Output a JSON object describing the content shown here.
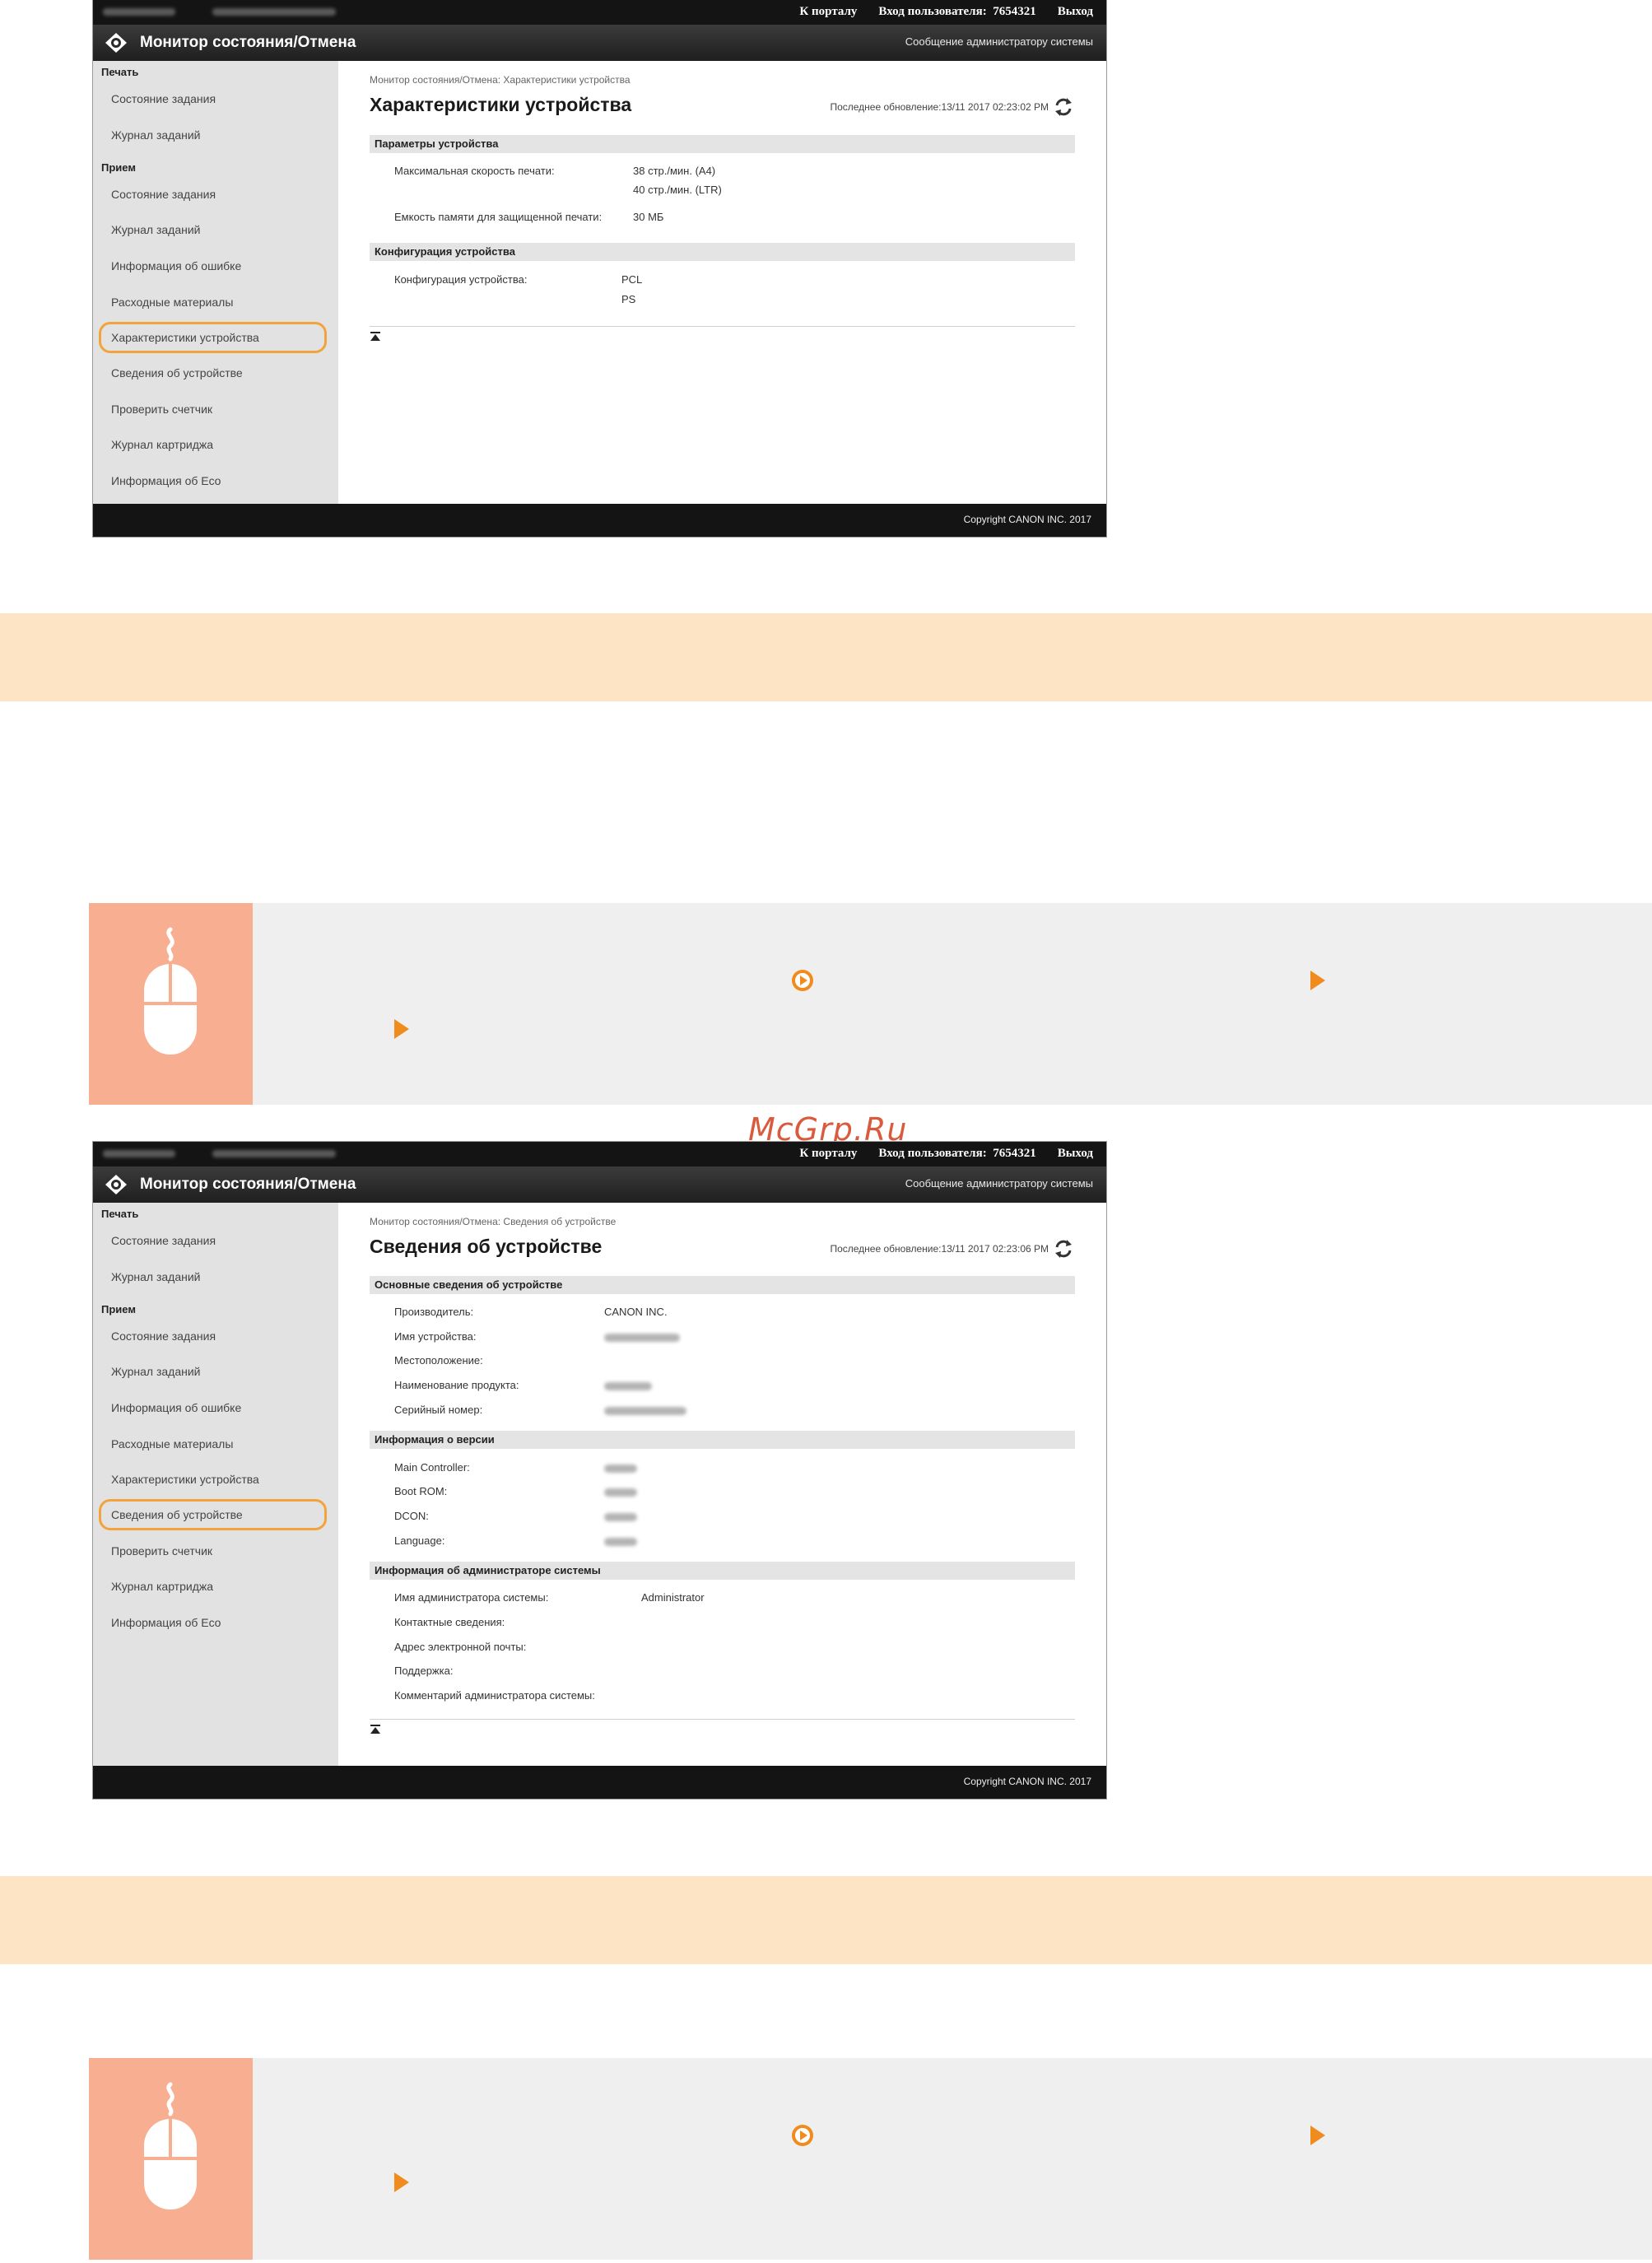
{
  "watermark": "McGrp.Ru",
  "topbar": {
    "portal_link": "К порталу",
    "login_label": "Вход пользователя:",
    "user_id": "7654321",
    "logout": "Выход"
  },
  "header": {
    "app_title": "Монитор состояния/Отмена",
    "admin_message": "Сообщение администратору системы",
    "logo_icon": "canon-remote-ui-logo-icon"
  },
  "sidebar": {
    "group_print": "Печать",
    "group_receive": "Прием",
    "print_items": [
      "Состояние задания",
      "Журнал заданий"
    ],
    "receive_items": [
      "Состояние задания",
      "Журнал заданий",
      "Информация об ошибке",
      "Расходные материалы",
      "Характеристики устройства",
      "Сведения об устройстве",
      "Проверить счетчик",
      "Журнал картриджа",
      "Информация об Eco"
    ]
  },
  "footer": {
    "copyright": "Copyright CANON INC. 2017"
  },
  "screen1": {
    "breadcrumb": "Монитор состояния/Отмена: Характеристики устройства",
    "title": "Характеристики устройства",
    "last_updated": "Последнее обновление:13/11 2017 02:23:02 PM",
    "selected_item": "Характеристики устройства",
    "sections": [
      {
        "title": "Параметры устройства",
        "rows": [
          {
            "label": "Максимальная скорость печати:",
            "values": [
              "38 стр./мин. (A4)",
              "40 стр./мин. (LTR)"
            ]
          },
          {
            "label": "Емкость памяти для защищенной печати:",
            "values": [
              "30 МБ"
            ]
          }
        ]
      },
      {
        "title": "Конфигурация устройства",
        "rows": [
          {
            "label": "Конфигурация устройства:",
            "values": [
              "PCL",
              "PS"
            ]
          }
        ]
      }
    ]
  },
  "screen2": {
    "breadcrumb": "Монитор состояния/Отмена: Сведения об устройстве",
    "title": "Сведения об устройстве",
    "last_updated": "Последнее обновление:13/11 2017 02:23:06 PM",
    "selected_item": "Сведения об устройстве",
    "sections": [
      {
        "title": "Основные сведения об устройстве",
        "rows": [
          {
            "label": "Производитель:",
            "value": "CANON INC."
          },
          {
            "label": "Имя устройства:",
            "value": ""
          },
          {
            "label": "Местоположение:",
            "value": ""
          },
          {
            "label": "Наименование продукта:",
            "value": ""
          },
          {
            "label": "Серийный номер:",
            "value": ""
          }
        ]
      },
      {
        "title": "Информация о версии",
        "rows": [
          {
            "label": "Main Controller:",
            "value": ""
          },
          {
            "label": "Boot ROM:",
            "value": ""
          },
          {
            "label": "DCON:",
            "value": ""
          },
          {
            "label": "Language:",
            "value": ""
          }
        ]
      },
      {
        "title": "Информация об администраторе системы",
        "rows": [
          {
            "label": "Имя администратора системы:",
            "value": "Administrator"
          },
          {
            "label": "Контактные сведения:",
            "value": ""
          },
          {
            "label": "Адрес электронной почты:",
            "value": ""
          },
          {
            "label": "Поддержка:",
            "value": ""
          },
          {
            "label": "Комментарий администратора системы:",
            "value": ""
          }
        ]
      }
    ]
  },
  "tips": {
    "icon": "mouse-operation-icon",
    "nav_icons": [
      "circle-arrow-icon",
      "triangle-arrow-icon"
    ]
  },
  "colors": {
    "band": "#fce4c4",
    "tip_icon_bg": "#f8ae91",
    "highlight": "#f3a33c",
    "accent_arrow": "#f08c1e"
  }
}
